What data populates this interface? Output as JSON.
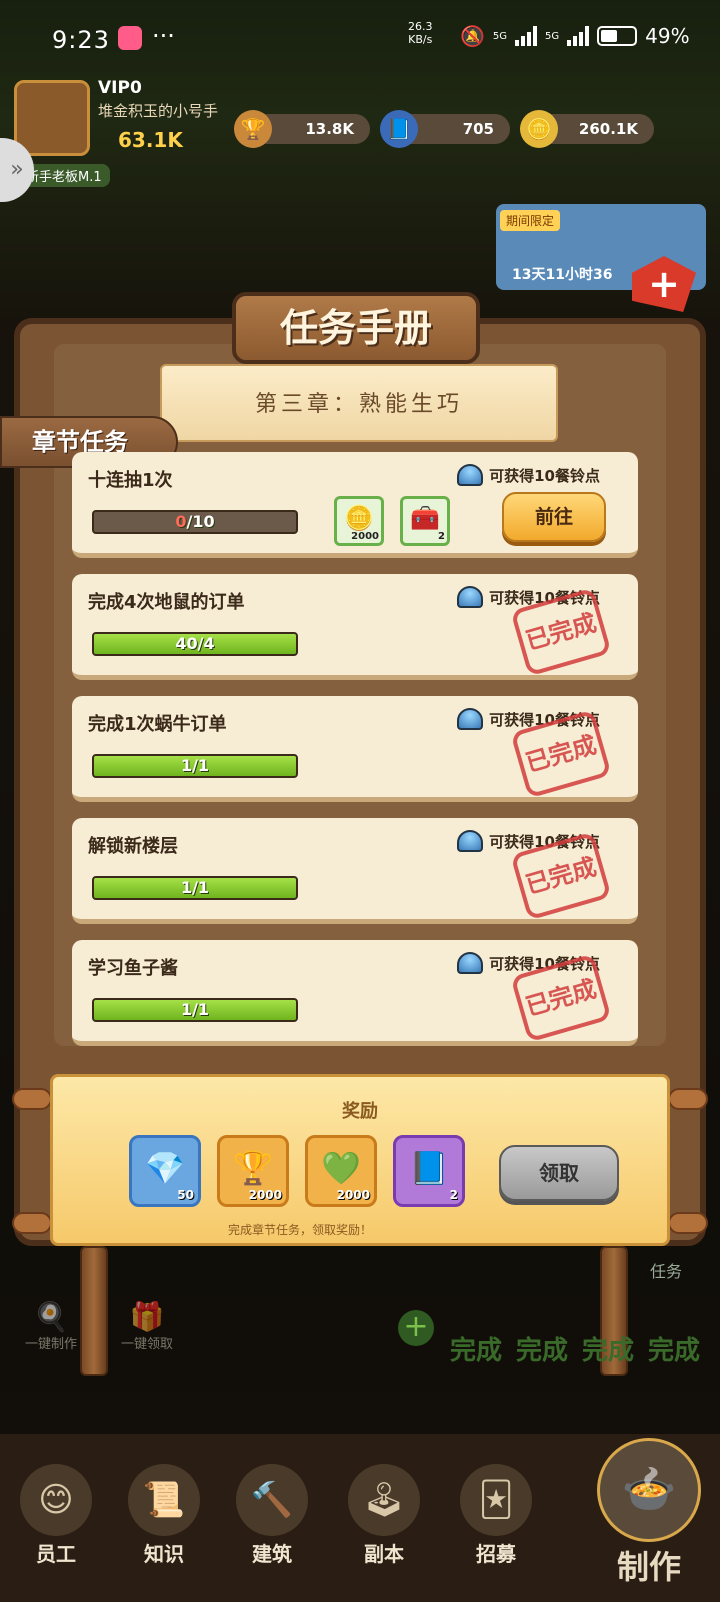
{
  "status_bar": {
    "time": "9:23",
    "dots": "···",
    "net_speed": "26.3",
    "net_unit": "KB/s",
    "sig1": "5G",
    "sig2": "5G",
    "battery": "49%"
  },
  "player": {
    "vip": "VIP0",
    "nickname": "堆金积玉的小号手",
    "cash": "63.1K",
    "rank": "新手老板M.1"
  },
  "resources": {
    "trophy": "13.8K",
    "gem": "705",
    "coin": "260.1K"
  },
  "promo": {
    "tag": "期间限定",
    "timer": "13天11小时36"
  },
  "board": {
    "title": "任务手册",
    "chapter": "第三章：熟能生巧",
    "tab": "章节任务",
    "tasks": [
      {
        "title": "十连抽1次",
        "reward": "可获得10餐铃点",
        "current": "0",
        "progress": "/10",
        "fraction": 0.0,
        "items": [
          {
            "icon": "coin-icon",
            "count": "2000"
          },
          {
            "icon": "chest-icon",
            "count": "2"
          }
        ],
        "button": "前往"
      },
      {
        "title": "完成4次地鼠的订单",
        "reward": "可获得10餐铃点",
        "progress": "40/4",
        "fraction": 1.0,
        "stamp": "已完成"
      },
      {
        "title": "完成1次蜗牛订单",
        "reward": "可获得10餐铃点",
        "progress": "1/1",
        "fraction": 1.0,
        "stamp": "已完成"
      },
      {
        "title": "解锁新楼层",
        "reward": "可获得10餐铃点",
        "progress": "1/1",
        "fraction": 1.0,
        "stamp": "已完成"
      },
      {
        "title": "学习鱼子酱",
        "reward": "可获得10餐铃点",
        "progress": "1/1",
        "fraction": 1.0,
        "stamp": "已完成"
      }
    ]
  },
  "reward_banner": {
    "title": "奖励",
    "items": [
      {
        "icon": "diamond-icon",
        "count": "50",
        "color": "#6aa6e0"
      },
      {
        "icon": "trophy-icon",
        "count": "2000",
        "color": "#e69a3a"
      },
      {
        "icon": "green-gem-icon",
        "count": "2000",
        "color": "#e69a3a"
      },
      {
        "icon": "skill-book-icon",
        "count": "2",
        "color": "#9a5ac8"
      }
    ],
    "claim_label": "领取",
    "hint": "完成章节任务，领取奖励！"
  },
  "background": {
    "one_click_make": "一键制作",
    "one_click_claim": "一键领取",
    "tasks_label": "任务",
    "done_label": "完成"
  },
  "nav": {
    "items": [
      "员工",
      "知识",
      "建筑",
      "副本",
      "招募"
    ],
    "make": "制作"
  }
}
